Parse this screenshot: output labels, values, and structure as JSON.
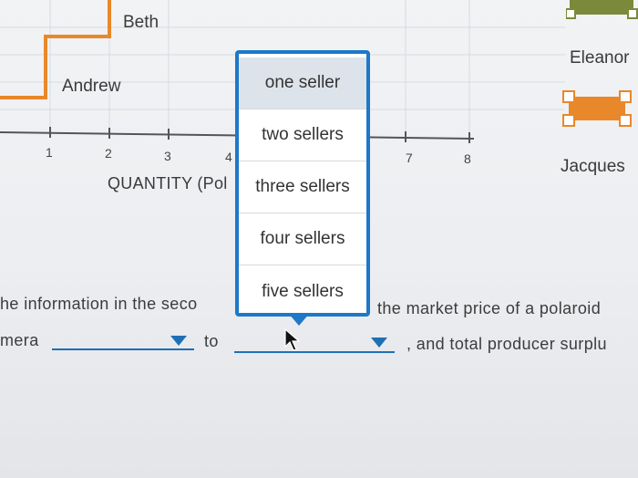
{
  "graph": {
    "seller_labels": {
      "beth": "Beth",
      "andrew": "Andrew",
      "eleanor": "Eleanor",
      "jacques": "Jacques"
    },
    "x_ticks": [
      "1",
      "2",
      "3",
      "4",
      "7",
      "8"
    ],
    "axis_title": "QUANTITY (Pol"
  },
  "dropdown": {
    "options": [
      "one seller",
      "two sellers",
      "three sellers",
      "four sellers",
      "five sellers"
    ],
    "selected": "one seller"
  },
  "question": {
    "line1_left": "he information in the seco",
    "line1_right": "the market price of a polaroid",
    "line2_start": "mera",
    "line2_mid": "to",
    "line2_end": ", and total producer surplu"
  },
  "colors": {
    "accent": "#1d78c8",
    "supply_curve": "#e8882a",
    "legend_green": "#7a8a3a"
  }
}
